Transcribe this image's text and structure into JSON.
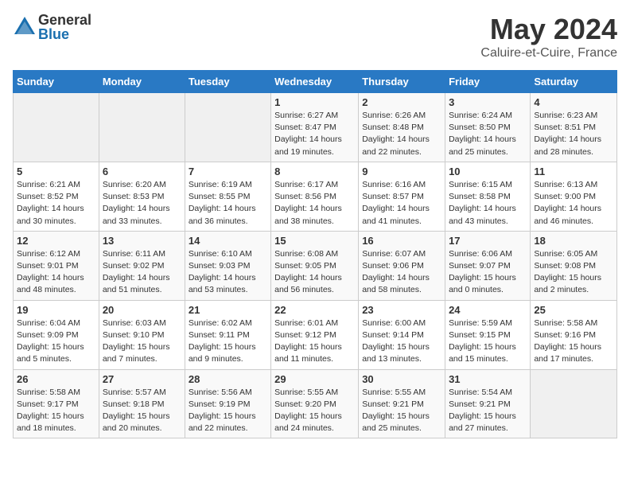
{
  "header": {
    "logo_general": "General",
    "logo_blue": "Blue",
    "title": "May 2024",
    "location": "Caluire-et-Cuire, France"
  },
  "days_of_week": [
    "Sunday",
    "Monday",
    "Tuesday",
    "Wednesday",
    "Thursday",
    "Friday",
    "Saturday"
  ],
  "weeks": [
    [
      {
        "num": "",
        "detail": ""
      },
      {
        "num": "",
        "detail": ""
      },
      {
        "num": "",
        "detail": ""
      },
      {
        "num": "1",
        "detail": "Sunrise: 6:27 AM\nSunset: 8:47 PM\nDaylight: 14 hours\nand 19 minutes."
      },
      {
        "num": "2",
        "detail": "Sunrise: 6:26 AM\nSunset: 8:48 PM\nDaylight: 14 hours\nand 22 minutes."
      },
      {
        "num": "3",
        "detail": "Sunrise: 6:24 AM\nSunset: 8:50 PM\nDaylight: 14 hours\nand 25 minutes."
      },
      {
        "num": "4",
        "detail": "Sunrise: 6:23 AM\nSunset: 8:51 PM\nDaylight: 14 hours\nand 28 minutes."
      }
    ],
    [
      {
        "num": "5",
        "detail": "Sunrise: 6:21 AM\nSunset: 8:52 PM\nDaylight: 14 hours\nand 30 minutes."
      },
      {
        "num": "6",
        "detail": "Sunrise: 6:20 AM\nSunset: 8:53 PM\nDaylight: 14 hours\nand 33 minutes."
      },
      {
        "num": "7",
        "detail": "Sunrise: 6:19 AM\nSunset: 8:55 PM\nDaylight: 14 hours\nand 36 minutes."
      },
      {
        "num": "8",
        "detail": "Sunrise: 6:17 AM\nSunset: 8:56 PM\nDaylight: 14 hours\nand 38 minutes."
      },
      {
        "num": "9",
        "detail": "Sunrise: 6:16 AM\nSunset: 8:57 PM\nDaylight: 14 hours\nand 41 minutes."
      },
      {
        "num": "10",
        "detail": "Sunrise: 6:15 AM\nSunset: 8:58 PM\nDaylight: 14 hours\nand 43 minutes."
      },
      {
        "num": "11",
        "detail": "Sunrise: 6:13 AM\nSunset: 9:00 PM\nDaylight: 14 hours\nand 46 minutes."
      }
    ],
    [
      {
        "num": "12",
        "detail": "Sunrise: 6:12 AM\nSunset: 9:01 PM\nDaylight: 14 hours\nand 48 minutes."
      },
      {
        "num": "13",
        "detail": "Sunrise: 6:11 AM\nSunset: 9:02 PM\nDaylight: 14 hours\nand 51 minutes."
      },
      {
        "num": "14",
        "detail": "Sunrise: 6:10 AM\nSunset: 9:03 PM\nDaylight: 14 hours\nand 53 minutes."
      },
      {
        "num": "15",
        "detail": "Sunrise: 6:08 AM\nSunset: 9:05 PM\nDaylight: 14 hours\nand 56 minutes."
      },
      {
        "num": "16",
        "detail": "Sunrise: 6:07 AM\nSunset: 9:06 PM\nDaylight: 14 hours\nand 58 minutes."
      },
      {
        "num": "17",
        "detail": "Sunrise: 6:06 AM\nSunset: 9:07 PM\nDaylight: 15 hours\nand 0 minutes."
      },
      {
        "num": "18",
        "detail": "Sunrise: 6:05 AM\nSunset: 9:08 PM\nDaylight: 15 hours\nand 2 minutes."
      }
    ],
    [
      {
        "num": "19",
        "detail": "Sunrise: 6:04 AM\nSunset: 9:09 PM\nDaylight: 15 hours\nand 5 minutes."
      },
      {
        "num": "20",
        "detail": "Sunrise: 6:03 AM\nSunset: 9:10 PM\nDaylight: 15 hours\nand 7 minutes."
      },
      {
        "num": "21",
        "detail": "Sunrise: 6:02 AM\nSunset: 9:11 PM\nDaylight: 15 hours\nand 9 minutes."
      },
      {
        "num": "22",
        "detail": "Sunrise: 6:01 AM\nSunset: 9:12 PM\nDaylight: 15 hours\nand 11 minutes."
      },
      {
        "num": "23",
        "detail": "Sunrise: 6:00 AM\nSunset: 9:14 PM\nDaylight: 15 hours\nand 13 minutes."
      },
      {
        "num": "24",
        "detail": "Sunrise: 5:59 AM\nSunset: 9:15 PM\nDaylight: 15 hours\nand 15 minutes."
      },
      {
        "num": "25",
        "detail": "Sunrise: 5:58 AM\nSunset: 9:16 PM\nDaylight: 15 hours\nand 17 minutes."
      }
    ],
    [
      {
        "num": "26",
        "detail": "Sunrise: 5:58 AM\nSunset: 9:17 PM\nDaylight: 15 hours\nand 18 minutes."
      },
      {
        "num": "27",
        "detail": "Sunrise: 5:57 AM\nSunset: 9:18 PM\nDaylight: 15 hours\nand 20 minutes."
      },
      {
        "num": "28",
        "detail": "Sunrise: 5:56 AM\nSunset: 9:19 PM\nDaylight: 15 hours\nand 22 minutes."
      },
      {
        "num": "29",
        "detail": "Sunrise: 5:55 AM\nSunset: 9:20 PM\nDaylight: 15 hours\nand 24 minutes."
      },
      {
        "num": "30",
        "detail": "Sunrise: 5:55 AM\nSunset: 9:21 PM\nDaylight: 15 hours\nand 25 minutes."
      },
      {
        "num": "31",
        "detail": "Sunrise: 5:54 AM\nSunset: 9:21 PM\nDaylight: 15 hours\nand 27 minutes."
      },
      {
        "num": "",
        "detail": ""
      }
    ]
  ]
}
